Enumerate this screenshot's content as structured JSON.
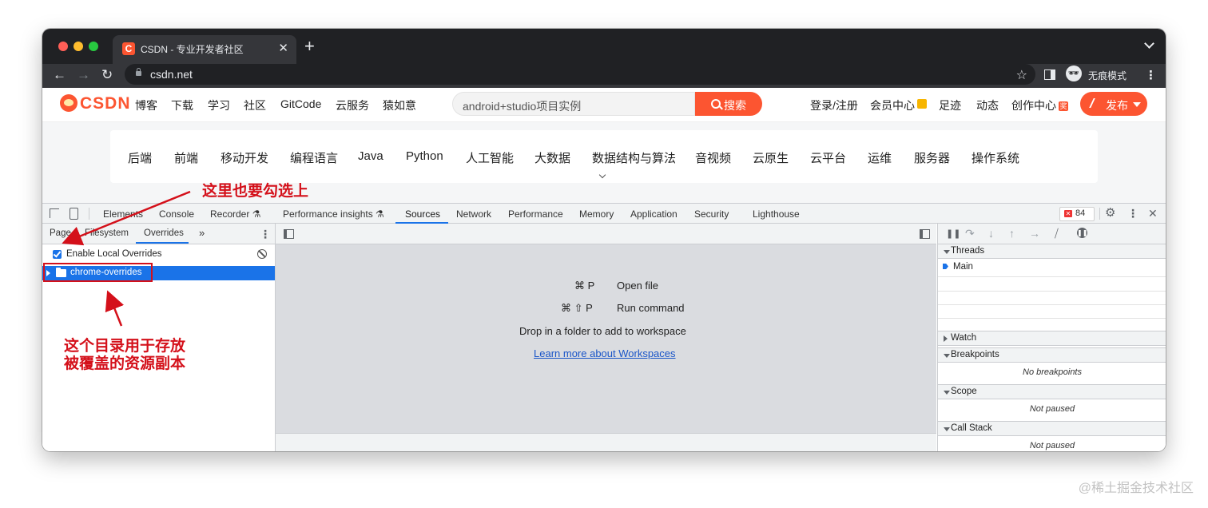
{
  "browser": {
    "tab_title": "CSDN - 专业开发者社区",
    "favicon_letter": "C",
    "new_tab": "+",
    "url": "csdn.net",
    "incognito_label": "无痕模式"
  },
  "csdn": {
    "logo": "CSDN",
    "nav": [
      "博客",
      "下载",
      "学习",
      "社区",
      "GitCode",
      "云服务",
      "猿如意"
    ],
    "search_value": "android+studio项目实例",
    "search_button": "搜索",
    "right_nav": [
      "登录/注册",
      "会员中心",
      "足迹",
      "动态",
      "创作中心"
    ],
    "vip_badge": "🎁",
    "creator_badge": "奖",
    "publish_button": "发布",
    "categories": [
      "后端",
      "前端",
      "移动开发",
      "编程语言",
      "Java",
      "Python",
      "人工智能",
      "大数据",
      "数据结构与算法",
      "音视频",
      "云原生",
      "云平台",
      "运维",
      "服务器",
      "操作系统"
    ]
  },
  "devtools": {
    "tabs": [
      "Elements",
      "Console",
      "Recorder ⚗",
      "Performance insights ⚗",
      "Sources",
      "Network",
      "Performance",
      "Memory",
      "Application",
      "Security",
      "Lighthouse"
    ],
    "active_tab": "Sources",
    "error_count": "84",
    "left_tabs": [
      "Page",
      "Filesystem",
      "Overrides",
      "»"
    ],
    "active_left_tab": "Overrides",
    "enable_overrides_label": "Enable Local Overrides",
    "enable_overrides_checked": true,
    "folder_name": "chrome-overrides",
    "shortcuts": [
      {
        "keys": "⌘ P",
        "label": "Open file"
      },
      {
        "keys": "⌘ ⇧ P",
        "label": "Run command"
      }
    ],
    "drop_text": "Drop in a folder to add to workspace",
    "learn_more": "Learn more about Workspaces",
    "sections": {
      "threads": "Threads",
      "main_thread": "Main",
      "watch": "Watch",
      "breakpoints": "Breakpoints",
      "no_breakpoints": "No breakpoints",
      "scope": "Scope",
      "scope_msg": "Not paused",
      "call_stack": "Call Stack",
      "call_stack_msg": "Not paused"
    }
  },
  "annotations": {
    "top_note": "这里也要勾选上",
    "bottom_note_line1": "这个目录用于存放",
    "bottom_note_line2": "被覆盖的资源副本",
    "annotation_color": "#d4101a"
  },
  "watermark": "@稀土掘金技术社区"
}
